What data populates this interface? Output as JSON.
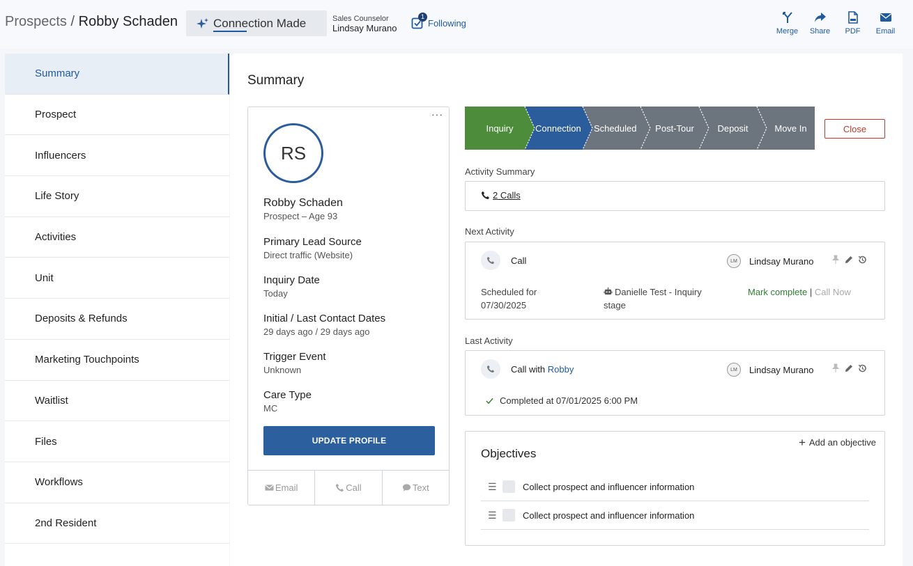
{
  "header": {
    "breadcrumb_root": "Prospects",
    "breadcrumb_separator": "/",
    "breadcrumb_name": "Robby Schaden",
    "stage_chip": "Connection Made",
    "counselor_label": "Sales Counselor",
    "counselor_name": "Lindsay Murano",
    "following_label": "Following",
    "following_count": "1",
    "actions": [
      {
        "label": "Merge",
        "icon": "merge-icon"
      },
      {
        "label": "Share",
        "icon": "share-icon"
      },
      {
        "label": "PDF",
        "icon": "pdf-icon"
      },
      {
        "label": "Email",
        "icon": "email-icon"
      }
    ]
  },
  "sidebar": {
    "items": [
      {
        "label": "Summary",
        "active": true
      },
      {
        "label": "Prospect"
      },
      {
        "label": "Influencers"
      },
      {
        "label": "Life Story"
      },
      {
        "label": "Activities"
      },
      {
        "label": "Unit"
      },
      {
        "label": "Deposits & Refunds"
      },
      {
        "label": "Marketing Touchpoints"
      },
      {
        "label": "Waitlist"
      },
      {
        "label": "Files"
      },
      {
        "label": "Workflows"
      },
      {
        "label": "2nd Resident"
      }
    ]
  },
  "main": {
    "title": "Summary",
    "profile": {
      "initials": "RS",
      "name": "Robby Schaden",
      "subtitle": "Prospect – Age 93",
      "fields": [
        {
          "label": "Primary Lead Source",
          "value": "Direct traffic (Website)"
        },
        {
          "label": "Inquiry Date",
          "value": "Today"
        },
        {
          "label": "Initial / Last Contact Dates",
          "value": "29 days ago / 29 days ago"
        },
        {
          "label": "Trigger Event",
          "value": "Unknown"
        },
        {
          "label": "Care Type",
          "value": "MC"
        }
      ],
      "update_button": "UPDATE PROFILE",
      "contact_buttons": [
        "Email",
        "Call",
        "Text"
      ],
      "menu_glyph": "···"
    },
    "pipeline": {
      "stages": [
        {
          "label": "Inquiry",
          "color": "#4d8c3a"
        },
        {
          "label": "Connection Made",
          "color": "#2b5d9c"
        },
        {
          "label": "Scheduled",
          "color": "#6c757d"
        },
        {
          "label": "Post-Tour",
          "color": "#6c757d"
        },
        {
          "label": "Deposit",
          "color": "#6c757d"
        },
        {
          "label": "Move In",
          "color": "#6c757d"
        }
      ],
      "close_button": "Close"
    },
    "activity_summary": {
      "label": "Activity Summary",
      "calls": "2 Calls"
    },
    "next_activity": {
      "label": "Next Activity",
      "type": "Call",
      "owner": "Lindsay Murano",
      "owner_initials": "LM",
      "scheduled_label": "Scheduled for",
      "scheduled_date": "07/30/2025",
      "assignee": "Danielle Test - Inquiry stage",
      "mark_complete": "Mark complete",
      "separator": "|",
      "call_now": "Call Now"
    },
    "last_activity": {
      "label": "Last Activity",
      "type_prefix": "Call with",
      "contact": "Robby",
      "owner": "Lindsay Murano",
      "owner_initials": "LM",
      "completed": "Completed at 07/01/2025 6:00 PM"
    },
    "objectives": {
      "title": "Objectives",
      "add_label": "Add an objective",
      "items": [
        "Collect prospect and influencer information",
        "Collect prospect and influencer information"
      ]
    }
  },
  "colors": {
    "accent": "#1f5aa0",
    "button_blue": "#2c5f9e",
    "close_red": "#c0392b",
    "complete_green": "#2e7d32"
  }
}
